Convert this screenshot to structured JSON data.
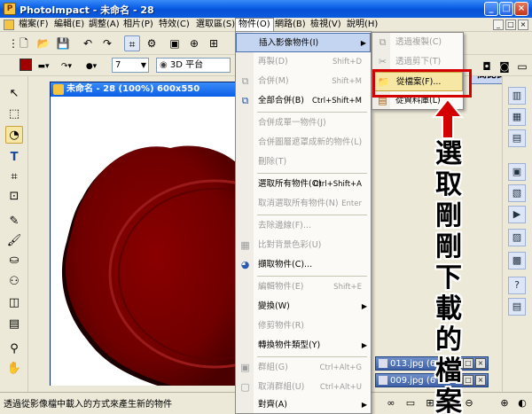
{
  "window": {
    "title": "PhotoImpact - 未命名 - 28"
  },
  "menubar": {
    "items": [
      "檔案(F)",
      "編輯(E)",
      "調整(A)",
      "相片(P)",
      "特效(C)",
      "選取區(S)",
      "物件(O)",
      "網路(B)",
      "檢視(V)",
      "說明(H)"
    ],
    "active_index": 6
  },
  "toolbar": {
    "font_size": "7",
    "mode_select": "3D 平台",
    "blue_button_label": "高比比"
  },
  "document": {
    "title": "未命名 - 28 (100%) 600x550"
  },
  "thumbnails": [
    {
      "label": "013.jpg (6"
    },
    {
      "label": "009.jpg (6"
    }
  ],
  "statusbar": {
    "message": "透過從影像檔中載入的方式來產生新的物件"
  },
  "object_menu": {
    "items": [
      {
        "label": "插入影像物件(I)",
        "shortcut": "",
        "submenu": true,
        "state": "highlight",
        "icon": ""
      },
      {
        "label": "再製(D)",
        "shortcut": "Shift+D",
        "state": "disabled",
        "icon": ""
      },
      {
        "label": "合併(M)",
        "shortcut": "Shift+M",
        "state": "disabled",
        "icon": "merge-icon"
      },
      {
        "label": "全部合併(B)",
        "shortcut": "Ctrl+Shift+M",
        "state": "enabled",
        "icon": "merge-all-icon"
      },
      {
        "label": "合併成單一物件(J)",
        "shortcut": "",
        "state": "disabled",
        "icon": ""
      },
      {
        "label": "合併圖層遮罩成新的物件(L)",
        "shortcut": "",
        "state": "disabled",
        "icon": ""
      },
      {
        "label": "刪除(T)",
        "shortcut": "",
        "state": "disabled",
        "icon": ""
      },
      {
        "label": "選取所有物件(O)",
        "shortcut": "Ctrl+Shift+A",
        "state": "enabled",
        "icon": ""
      },
      {
        "label": "取消選取所有物件(N)",
        "shortcut": "Enter",
        "state": "disabled",
        "icon": ""
      },
      {
        "label": "去除邊線(F)...",
        "shortcut": "",
        "state": "disabled",
        "icon": ""
      },
      {
        "label": "比對背景色彩(U)",
        "shortcut": "",
        "state": "disabled",
        "icon": "match-color-icon"
      },
      {
        "label": "擷取物件(C)...",
        "shortcut": "",
        "state": "enabled",
        "icon": "extract-object-icon"
      },
      {
        "label": "編輯物件(E)",
        "shortcut": "Shift+E",
        "state": "disabled",
        "icon": ""
      },
      {
        "label": "變換(W)",
        "shortcut": "",
        "submenu": true,
        "state": "enabled",
        "icon": ""
      },
      {
        "label": "修剪物件(R)",
        "shortcut": "",
        "state": "disabled",
        "icon": ""
      },
      {
        "label": "轉換物件類型(Y)",
        "shortcut": "",
        "submenu": true,
        "state": "enabled",
        "icon": ""
      },
      {
        "label": "群組(G)",
        "shortcut": "Ctrl+Alt+G",
        "state": "disabled",
        "icon": "group-icon"
      },
      {
        "label": "取消群組(U)",
        "shortcut": "Ctrl+Alt+U",
        "state": "disabled",
        "icon": "ungroup-icon"
      },
      {
        "label": "對齊(A)",
        "shortcut": "",
        "submenu": true,
        "state": "enabled",
        "icon": ""
      }
    ]
  },
  "insert_submenu": {
    "items": [
      {
        "label": "透過複製(C)",
        "state": "disabled",
        "icon": "copy-icon"
      },
      {
        "label": "透過剪下(T)",
        "state": "disabled",
        "icon": "cut-icon"
      },
      {
        "label": "從檔案(F)...",
        "state": "highlight",
        "icon": "folder-icon"
      },
      {
        "label": "從資料庫(L)",
        "state": "enabled",
        "icon": "library-icon"
      }
    ]
  },
  "annotation": {
    "text": [
      "選",
      "取",
      "剛",
      "剛",
      "下",
      "載",
      "的",
      "檔",
      "案"
    ],
    "color": "#d40000"
  },
  "colors": {
    "primary_color": "#a00000",
    "seal_color": "#7a0000",
    "titlebar_blue": "#0a5fe6"
  }
}
